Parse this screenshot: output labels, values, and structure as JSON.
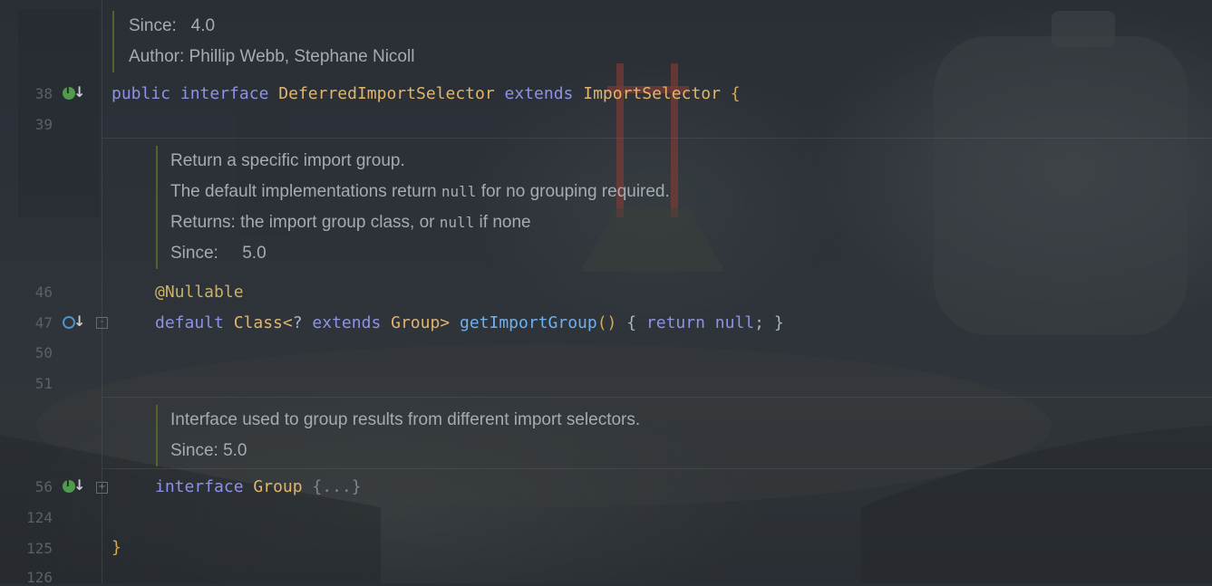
{
  "doc_top": {
    "since_label": "Since:",
    "since_value": "4.0",
    "author": "Author: Phillip Webb, Stephane Nicoll"
  },
  "line_numbers": {
    "l38": "38",
    "l39": "39",
    "l46": "46",
    "l47": "47",
    "l50": "50",
    "l51": "51",
    "l56": "56",
    "l124": "124",
    "l125": "125",
    "l126": "126"
  },
  "line38": {
    "kw1": "public",
    "kw2": "interface",
    "name": "DeferredImportSelector",
    "kw3": "extends",
    "parent": "ImportSelector",
    "brace": "{"
  },
  "doc_method": {
    "line1": "Return a specific import group.",
    "line2_pre": "The default implementations return ",
    "line2_code": "null",
    "line2_post": " for no grouping required.",
    "line3_pre": "Returns: the import group class, or ",
    "line3_code": "null",
    "line3_post": " if none",
    "since_label": "Since:",
    "since_value": "5.0"
  },
  "line46": {
    "annotation": "@Nullable"
  },
  "line47": {
    "kw1": "default",
    "type": "Class<",
    "q": "? ",
    "kw2": "extends",
    "group": "Group>",
    "method": "getImportGroup",
    "parens": "()",
    "open": " { ",
    "kw3": "return",
    "nullkw": "null",
    "close": "; }"
  },
  "doc_group": {
    "line1": "Interface used to group results from different import selectors.",
    "line2": "Since: 5.0"
  },
  "line56": {
    "kw": "interface",
    "name": "Group",
    "folded": "{...}"
  },
  "line125": {
    "brace": "}"
  },
  "icons": {
    "implemented": "implemented-icon",
    "overrides": "overrides-icon",
    "fold": "fold-icon"
  }
}
